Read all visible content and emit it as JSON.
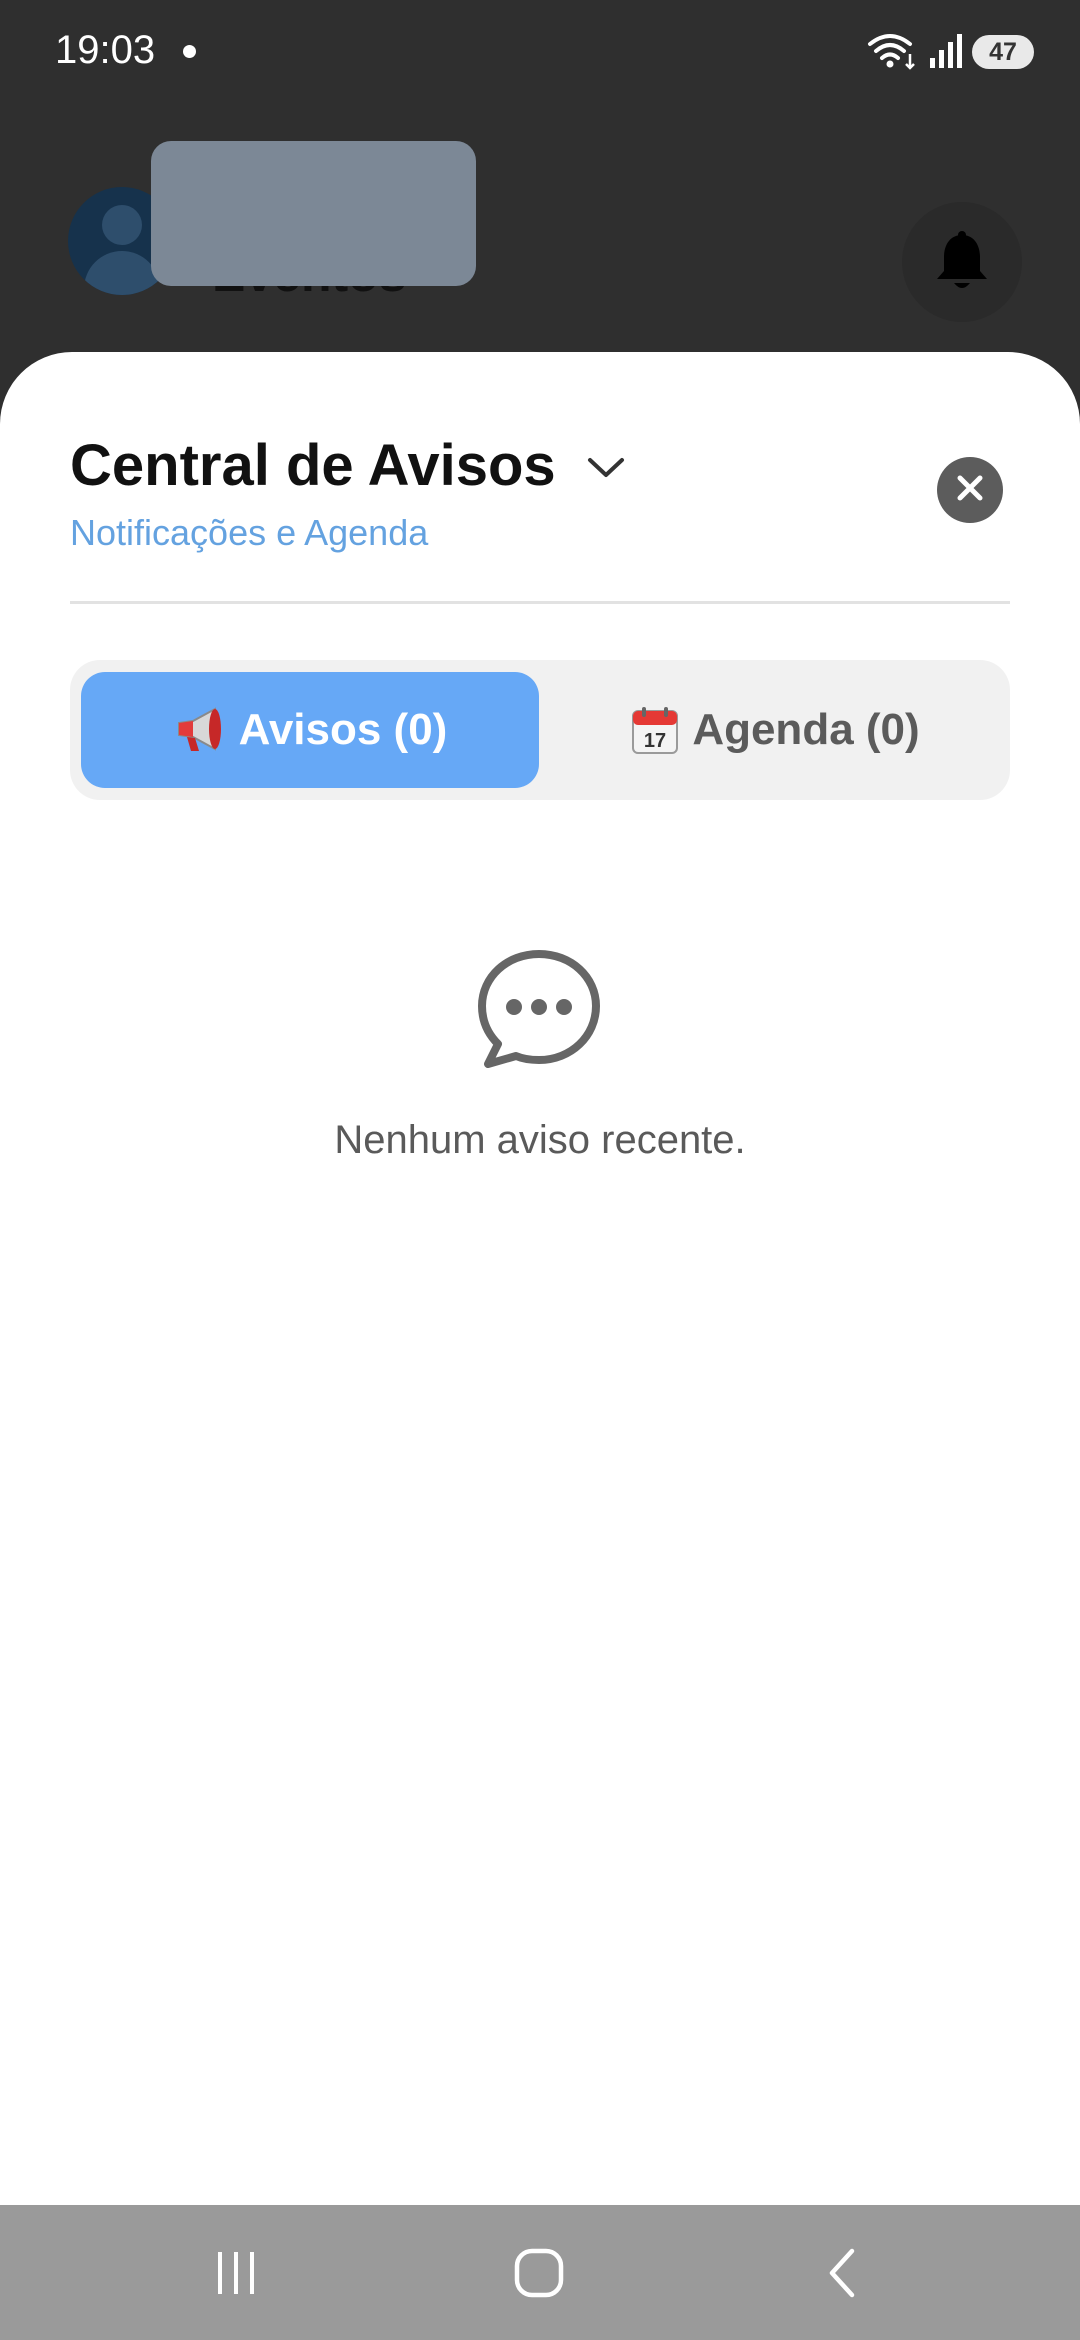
{
  "status_bar": {
    "time": "19:03",
    "battery": "47",
    "icons": [
      "wifi-icon",
      "signal-icon",
      "battery-icon"
    ]
  },
  "background_screen": {
    "title": "Eventos",
    "icons": [
      "avatar-icon",
      "bell-icon"
    ]
  },
  "sheet": {
    "title": "Central de Avisos",
    "subtitle": "Notificações e Agenda",
    "icons": [
      "chevron-down-icon",
      "close-icon"
    ],
    "tabs": [
      {
        "label": "Avisos (0)",
        "emoji": "📢",
        "icon": "megaphone-icon",
        "active": true
      },
      {
        "label": "Agenda (0)",
        "emoji": "📆",
        "icon": "calendar-icon",
        "active": false
      }
    ],
    "empty_state": {
      "icon": "chat-bubble-icon",
      "message": "Nenhum aviso recente."
    }
  },
  "nav_bar": {
    "icons": [
      "recents-icon",
      "home-icon",
      "back-icon"
    ]
  },
  "colors": {
    "accent": "#66a8f6",
    "subtitle": "#64a2e0",
    "close_button": "#5c5c5c",
    "dim_background": "#2f2f2f",
    "nav_bar": "#9a9a9a"
  }
}
